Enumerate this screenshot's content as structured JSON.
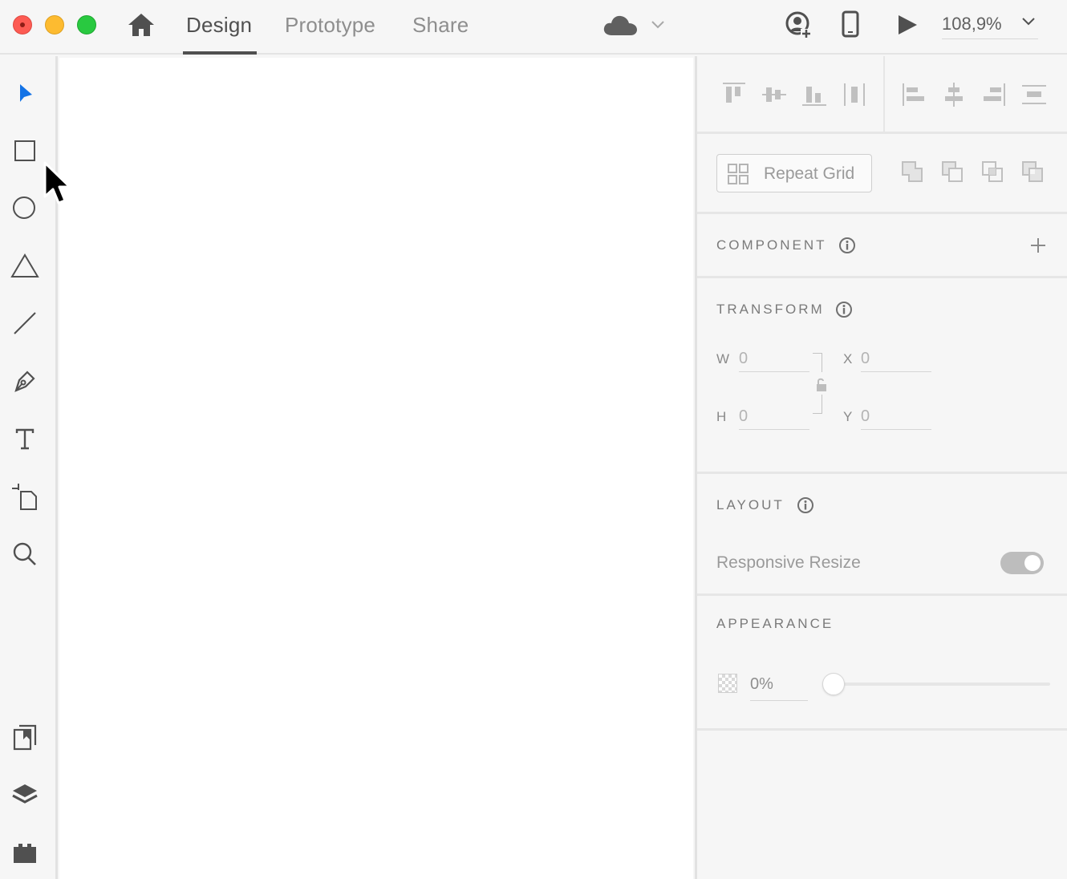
{
  "window": {
    "controls": [
      "close",
      "minimize",
      "zoom"
    ]
  },
  "header": {
    "tabs": [
      {
        "label": "Design",
        "active": true
      },
      {
        "label": "Prototype",
        "active": false
      },
      {
        "label": "Share",
        "active": false
      }
    ],
    "icons": [
      "home-icon",
      "cloud-icon",
      "chevron-down-icon",
      "invite-user-icon",
      "mobile-preview-icon",
      "play-icon"
    ],
    "zoom_label": "108,9%"
  },
  "toolbar": {
    "tools": [
      "select-icon",
      "rectangle-icon",
      "ellipse-icon",
      "polygon-icon",
      "line-icon",
      "pen-icon",
      "text-icon",
      "artboard-icon",
      "zoom-icon"
    ],
    "bottom_tools": [
      "assets-icon",
      "layers-icon",
      "plugins-icon"
    ],
    "active_tool": "select-icon",
    "accent_color": "#1473e6"
  },
  "panel": {
    "repeat_grid_label": "Repeat Grid",
    "component": {
      "title": "COMPONENT"
    },
    "transform": {
      "title": "TRANSFORM",
      "w_label": "W",
      "w_value": "0",
      "h_label": "H",
      "h_value": "0",
      "x_label": "X",
      "x_value": "0",
      "y_label": "Y",
      "y_value": "0"
    },
    "layout": {
      "title": "LAYOUT",
      "responsive_resize_label": "Responsive Resize",
      "responsive_resize_on": true
    },
    "appearance": {
      "title": "APPEARANCE",
      "opacity_value": "0%",
      "opacity_fraction": 0
    }
  }
}
